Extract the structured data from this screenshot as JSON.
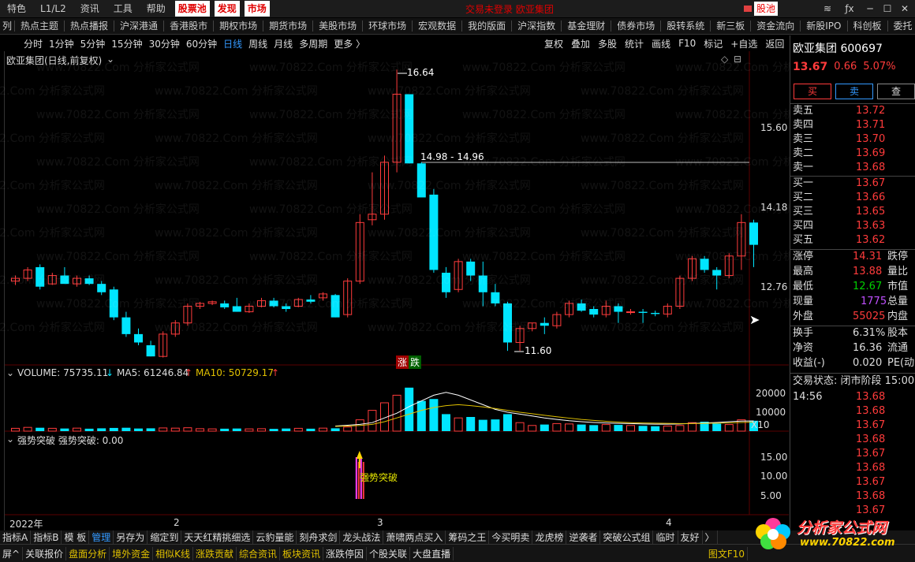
{
  "topbar": {
    "items": [
      "特色",
      "L1/L2",
      "资讯",
      "工具",
      "帮助"
    ],
    "highlighted": [
      "股票池",
      "发现",
      "市场"
    ],
    "window_title": "交易未登录   欧亚集团",
    "pool_label": "股池"
  },
  "menu2": [
    "热点主题",
    "热点播报",
    "沪深港通",
    "香港股市",
    "期权市场",
    "期货市场",
    "美股市场",
    "环球市场",
    "宏观数据",
    "我的版面",
    "沪深指数",
    "基金理财",
    "债券市场",
    "股转系统",
    "新三板",
    "资金流向",
    "新股IPO",
    "科创板",
    "委托"
  ],
  "periods": [
    "分时",
    "1分钟",
    "5分钟",
    "15分钟",
    "30分钟",
    "60分钟",
    "日线",
    "周线",
    "月线",
    "多周期",
    "更多 〉"
  ],
  "period_selected": "日线",
  "right_tools": [
    "复权",
    "叠加",
    "多股",
    "统计",
    "画线",
    "F10",
    "标记",
    "+自选",
    "返回"
  ],
  "chart_title": "欧亚集团(日线,前复权)",
  "volume_header": {
    "label": "VOLUME: 75735.11",
    "ma5": "MA5: 61246.84",
    "ma10": "MA10: 50729.17"
  },
  "indicator_header": {
    "label": "强势突破  强势突破: 0.00",
    "signal": "强势突破"
  },
  "limit_badges": {
    "up": "涨",
    "down": "跌"
  },
  "annotations": {
    "high": "16.64",
    "low": "11.60",
    "range": "14.98 - 14.96"
  },
  "x_axis": {
    "labels": [
      "2022年",
      "2",
      "3",
      "4"
    ]
  },
  "vol_scale_label": "X10",
  "chart_data": {
    "type": "candlestick",
    "price_axis": {
      "ticks": [
        15.6,
        14.18,
        12.76
      ],
      "labels": [
        "15.60",
        "14.18",
        "12.76"
      ]
    },
    "volume_axis": {
      "ticks": [
        20000,
        10000
      ],
      "labels": [
        "20000",
        "10000"
      ]
    },
    "indicator_axis": {
      "ticks": [
        15,
        10,
        5
      ],
      "labels": [
        "15.00",
        "10.00",
        "5.00"
      ]
    },
    "candles": [
      [
        12.85,
        12.95,
        12.78,
        12.9
      ],
      [
        12.9,
        13.1,
        12.85,
        13.05
      ],
      [
        13.1,
        13.15,
        12.7,
        12.75
      ],
      [
        12.8,
        13.0,
        12.78,
        12.95
      ],
      [
        12.95,
        13.1,
        12.85,
        12.8
      ],
      [
        12.8,
        12.95,
        12.75,
        12.9
      ],
      [
        12.9,
        12.95,
        12.78,
        12.8
      ],
      [
        12.8,
        12.85,
        12.6,
        12.65
      ],
      [
        12.7,
        12.75,
        12.15,
        12.2
      ],
      [
        12.2,
        12.3,
        11.85,
        11.9
      ],
      [
        11.9,
        12.0,
        11.7,
        11.75
      ],
      [
        11.7,
        11.78,
        11.5,
        11.5
      ],
      [
        11.5,
        11.95,
        11.48,
        11.9
      ],
      [
        11.9,
        12.15,
        11.85,
        12.1
      ],
      [
        12.1,
        12.45,
        12.05,
        12.4
      ],
      [
        12.4,
        12.48,
        12.35,
        12.45
      ],
      [
        12.45,
        12.5,
        12.42,
        12.48
      ],
      [
        12.45,
        12.5,
        12.35,
        12.38
      ],
      [
        12.4,
        12.55,
        12.3,
        12.3
      ],
      [
        12.3,
        12.45,
        12.28,
        12.4
      ],
      [
        12.4,
        12.55,
        12.38,
        12.5
      ],
      [
        12.5,
        12.55,
        12.38,
        12.4
      ],
      [
        12.4,
        12.45,
        12.3,
        12.35
      ],
      [
        12.4,
        12.55,
        12.38,
        12.52
      ],
      [
        12.52,
        12.6,
        12.45,
        12.48
      ],
      [
        12.55,
        12.65,
        12.5,
        12.62
      ],
      [
        12.6,
        12.62,
        12.2,
        12.2
      ],
      [
        12.25,
        12.9,
        12.2,
        12.85
      ],
      [
        12.85,
        14.05,
        12.8,
        13.9
      ],
      [
        13.95,
        14.8,
        13.85,
        14.05
      ],
      [
        14.05,
        15.1,
        13.95,
        14.98
      ],
      [
        14.98,
        16.64,
        14.8,
        16.2
      ],
      [
        16.2,
        15.9,
        14.96,
        14.96
      ],
      [
        14.96,
        14.98,
        14.4,
        14.35
      ],
      [
        14.4,
        14.5,
        13.0,
        13.05
      ],
      [
        13.0,
        13.1,
        12.55,
        12.65
      ],
      [
        12.7,
        13.25,
        12.65,
        13.2
      ],
      [
        13.2,
        13.25,
        12.85,
        12.95
      ],
      [
        12.95,
        13.2,
        12.4,
        12.65
      ],
      [
        12.65,
        12.8,
        12.4,
        12.45
      ],
      [
        12.45,
        12.48,
        11.6,
        11.75
      ],
      [
        11.75,
        12.05,
        11.6,
        12.0
      ],
      [
        12.0,
        12.1,
        11.95,
        12.1
      ],
      [
        12.1,
        12.2,
        11.9,
        12.05
      ],
      [
        12.05,
        12.3,
        12.0,
        12.25
      ],
      [
        12.25,
        12.5,
        12.2,
        12.45
      ],
      [
        12.45,
        12.52,
        12.3,
        12.32
      ],
      [
        12.35,
        12.4,
        12.2,
        12.25
      ],
      [
        12.25,
        12.5,
        12.2,
        12.4
      ],
      [
        12.4,
        12.45,
        12.1,
        12.3
      ],
      [
        12.3,
        12.35,
        12.25,
        12.3
      ],
      [
        12.3,
        12.35,
        12.1,
        12.28
      ],
      [
        12.28,
        12.32,
        12.22,
        12.26
      ],
      [
        12.26,
        12.45,
        12.2,
        12.4
      ],
      [
        12.4,
        12.95,
        12.35,
        12.9
      ],
      [
        12.9,
        13.3,
        12.85,
        13.25
      ],
      [
        13.25,
        13.3,
        13.0,
        13.05
      ],
      [
        13.05,
        13.1,
        12.7,
        12.95
      ],
      [
        12.95,
        13.35,
        12.9,
        13.3
      ],
      [
        13.3,
        14.05,
        13.05,
        13.9
      ],
      [
        13.9,
        13.95,
        13.1,
        13.5
      ]
    ],
    "volume": [
      1500,
      2000,
      1800,
      1500,
      1400,
      1600,
      1300,
      1500,
      1700,
      1800,
      1400,
      1500,
      1700,
      1600,
      1800,
      1300,
      1200,
      1300,
      1400,
      1200,
      1300,
      1200,
      1400,
      1500,
      1300,
      1600,
      1500,
      2200,
      6000,
      11000,
      15000,
      19000,
      23000,
      16000,
      17000,
      9000,
      7000,
      7500,
      6000,
      6200,
      9000,
      4500,
      3000,
      3500,
      4000,
      3800,
      3500,
      3200,
      3500,
      3300,
      3000,
      2800,
      2600,
      2700,
      3000,
      4500,
      5000,
      4000,
      3500,
      6000,
      5500
    ],
    "ma5": [
      2700,
      3100,
      3600,
      4500,
      7000,
      9500,
      13000,
      16000,
      19000,
      20500,
      19000,
      16500,
      14000,
      11500,
      10000,
      9000,
      8000,
      7000,
      6200,
      5500,
      5000,
      4600,
      4300,
      4100,
      4000,
      3800,
      3700,
      3700,
      3800,
      4100,
      4300,
      4600,
      5000,
      5300,
      5400
    ],
    "ma10": [
      2500,
      2700,
      3000,
      3600,
      5000,
      7000,
      9000,
      11000,
      12500,
      13500,
      14000,
      13500,
      12800,
      12000,
      11000,
      10000,
      9200,
      8400,
      7600,
      6900,
      6200,
      5700,
      5200,
      4800,
      4500,
      4300,
      4200,
      4100,
      4000,
      4000,
      4100,
      4200,
      4400,
      4600,
      4800
    ],
    "indicator_index": 28,
    "indicator_value": 15
  },
  "quote": {
    "name": "欧亚集团  600697",
    "price": "13.67",
    "change": "0.66",
    "pct": "5.07%",
    "buy_btn": "买",
    "sell_btn": "卖",
    "query_btn": "查",
    "asks": [
      [
        "卖五",
        "13.72"
      ],
      [
        "卖四",
        "13.71"
      ],
      [
        "卖三",
        "13.70"
      ],
      [
        "卖二",
        "13.69"
      ],
      [
        "卖一",
        "13.68"
      ]
    ],
    "bids": [
      [
        "买一",
        "13.67"
      ],
      [
        "买二",
        "13.66"
      ],
      [
        "买三",
        "13.65"
      ],
      [
        "买四",
        "13.63"
      ],
      [
        "买五",
        "13.62"
      ]
    ],
    "stats": [
      [
        "涨停",
        "14.31",
        "跌停"
      ],
      [
        "最高",
        "13.88",
        "量比"
      ],
      [
        "最低",
        "12.67",
        "市值"
      ],
      [
        "现量",
        "1775",
        "总量"
      ],
      [
        "外盘",
        "55025",
        "内盘"
      ]
    ],
    "stats2": [
      [
        "换手",
        "6.31%",
        "股本"
      ],
      [
        "净资",
        "16.36",
        "流通"
      ],
      [
        "收益(-)",
        "0.020",
        "PE(动"
      ]
    ],
    "trade_status": "交易状态: 闭市阶段  15:00",
    "tick_time": "14:56",
    "ticks": [
      "13.68",
      "13.68",
      "13.67",
      "13.68",
      "13.67",
      "13.68",
      "13.67",
      "13.68",
      "13.67"
    ],
    "colors": {
      "up": "#ff3b3b",
      "down": "#00e5ff",
      "purple": "#c050ff",
      "green": "#00d000",
      "yellow": "#e0c000"
    }
  },
  "bottom1": [
    "指标A",
    "指标B",
    "模 板",
    "管理",
    "另存为",
    "缩定到",
    "天天红精挑细选",
    "云豹量能",
    "刻舟求剑",
    "龙头战法",
    "萧啸两点买入",
    "筹码之王",
    "今买明卖",
    "龙虎榜",
    "逆袭者",
    "突破公式组",
    "临时",
    "友好",
    "〉"
  ],
  "bottom2": [
    "屏^",
    "关联报价",
    "盘面分析",
    "境外资金",
    "相似K线",
    "涨跌贡献",
    "综合资讯",
    "板块资讯",
    "涨跌停因",
    "个股关联",
    "大盘直播"
  ],
  "bottom2_right": "图文F10",
  "logo": {
    "text": "分析家公式网",
    "url": "www.70822.com"
  },
  "watermark": "www.70822.Com 分析家公式网"
}
